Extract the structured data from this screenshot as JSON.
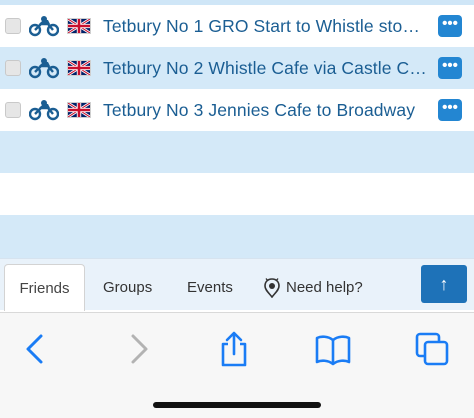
{
  "routes": [
    {
      "title": "Tetbury No 1 GRO Start to Whistle stop ...",
      "checked": false
    },
    {
      "title": "Tetbury No 2 Whistle Cafe via Castle Co...",
      "checked": false
    },
    {
      "title": "Tetbury No 3 Jennies Cafe to Broadway",
      "checked": false
    }
  ],
  "more_label": "•••",
  "tabs": {
    "friends": "Friends",
    "groups": "Groups",
    "events": "Events",
    "help": "Need help?"
  },
  "up_label": "↑",
  "icons": {
    "vehicle": "motorcycle-icon",
    "flag": "uk-flag-icon",
    "help": "assistant-icon",
    "back": "back-chevron-icon",
    "forward": "forward-chevron-icon",
    "share": "share-icon",
    "bookmarks": "bookmarks-icon",
    "tabs": "tabs-icon"
  },
  "colors": {
    "accent": "#2386d2",
    "title": "#1b5e93",
    "row_highlight": "#d4e9f8",
    "up_button": "#1e72b8",
    "safari_blue": "#1a7cf5"
  }
}
